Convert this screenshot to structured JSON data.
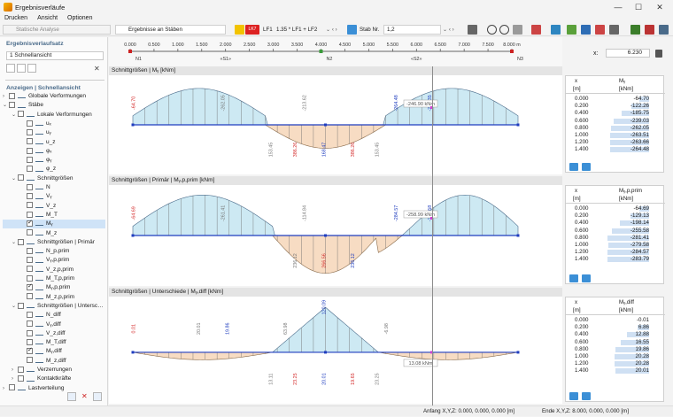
{
  "window": {
    "title": "Ergebnisverläufe"
  },
  "menu": [
    "Drucken",
    "Ansicht",
    "Optionen"
  ],
  "toolbar": {
    "analysis": "Statische Analyse",
    "results_on": "Ergebnisse an Stäben",
    "lc_code": "LK7",
    "lc_name": "LF1",
    "combo_text": "1.35 * LF1 + LF2",
    "member_label": "Stab Nr.",
    "member_value": "1,2"
  },
  "panel": {
    "title": "Ergebnisverlaufsatz",
    "selection": "1   Schnellansicht",
    "display_header": "Anzeigen | Schnellansicht",
    "tree": [
      {
        "label": "Globale Verformungen",
        "level": 0,
        "checked": false,
        "caret": ">"
      },
      {
        "label": "Stäbe",
        "level": 0,
        "checked": false,
        "caret": "v"
      },
      {
        "label": "Lokale Verformungen",
        "level": 1,
        "checked": false,
        "caret": "v"
      },
      {
        "label": "uₓ",
        "level": 2,
        "checked": false,
        "caret": ""
      },
      {
        "label": "uᵧ",
        "level": 2,
        "checked": false,
        "caret": ""
      },
      {
        "label": "u_z",
        "level": 2,
        "checked": false,
        "caret": ""
      },
      {
        "label": "φₓ",
        "level": 2,
        "checked": false,
        "caret": ""
      },
      {
        "label": "φᵧ",
        "level": 2,
        "checked": false,
        "caret": ""
      },
      {
        "label": "φ_z",
        "level": 2,
        "checked": false,
        "caret": ""
      },
      {
        "label": "Schnittgrößen",
        "level": 1,
        "checked": false,
        "caret": "v"
      },
      {
        "label": "N",
        "level": 2,
        "checked": false,
        "caret": ""
      },
      {
        "label": "Vᵧ",
        "level": 2,
        "checked": false,
        "caret": ""
      },
      {
        "label": "V_z",
        "level": 2,
        "checked": false,
        "caret": ""
      },
      {
        "label": "M_T",
        "level": 2,
        "checked": false,
        "caret": ""
      },
      {
        "label": "Mᵧ",
        "level": 2,
        "checked": true,
        "caret": "",
        "selected": true
      },
      {
        "label": "M_z",
        "level": 2,
        "checked": false,
        "caret": ""
      },
      {
        "label": "Schnittgrößen | Primär",
        "level": 1,
        "checked": false,
        "caret": "v"
      },
      {
        "label": "N_p,prim",
        "level": 2,
        "checked": false,
        "caret": ""
      },
      {
        "label": "Vᵧ,p,prim",
        "level": 2,
        "checked": false,
        "caret": ""
      },
      {
        "label": "V_z,p,prim",
        "level": 2,
        "checked": false,
        "caret": ""
      },
      {
        "label": "M_T,p,prim",
        "level": 2,
        "checked": false,
        "caret": ""
      },
      {
        "label": "Mᵧ,p,prim",
        "level": 2,
        "checked": true,
        "caret": ""
      },
      {
        "label": "M_z,p,prim",
        "level": 2,
        "checked": false,
        "caret": ""
      },
      {
        "label": "Schnittgrößen | Untersc…",
        "level": 1,
        "checked": false,
        "caret": "v"
      },
      {
        "label": "N_diff",
        "level": 2,
        "checked": false,
        "caret": ""
      },
      {
        "label": "Vᵧ,diff",
        "level": 2,
        "checked": false,
        "caret": ""
      },
      {
        "label": "V_z,diff",
        "level": 2,
        "checked": false,
        "caret": ""
      },
      {
        "label": "M_T,diff",
        "level": 2,
        "checked": false,
        "caret": ""
      },
      {
        "label": "Mᵧ,diff",
        "level": 2,
        "checked": true,
        "caret": ""
      },
      {
        "label": "M_z,diff",
        "level": 2,
        "checked": false,
        "caret": ""
      },
      {
        "label": "Verzerrungen",
        "level": 1,
        "checked": false,
        "caret": ">"
      },
      {
        "label": "Kontaktkräfte",
        "level": 1,
        "checked": false,
        "caret": ">"
      },
      {
        "label": "Lastverteilung",
        "level": 0,
        "checked": false,
        "caret": ">"
      }
    ]
  },
  "ruler": {
    "ticks": [
      "0.000",
      "0.500",
      "1.000",
      "1.500",
      "2.000",
      "2.500",
      "3.000",
      "3.500",
      "4.000",
      "4.500",
      "5.000",
      "5.500",
      "6.000",
      "6.500",
      "7.000",
      "7.500",
      "8.000 m"
    ],
    "nodes": [
      "N1",
      "N2",
      "N3"
    ],
    "members": [
      "«S1»",
      "«S2»"
    ],
    "x_label": "x:",
    "x_value": "6.230"
  },
  "charts": [
    {
      "header": "Schnittgrößen | Mᵧ [kNm]",
      "tooltip": "-246.90 kNm",
      "table_col": "Mᵧ",
      "table_unit": "[kNm]",
      "rows": [
        [
          "0.000",
          "-64.70"
        ],
        [
          "0.200",
          "-122.26"
        ],
        [
          "0.400",
          "-185.75"
        ],
        [
          "0.600",
          "-239.03"
        ],
        [
          "0.800",
          "-262.05"
        ],
        [
          "1.000",
          "-263.51"
        ],
        [
          "1.200",
          "-263.66"
        ],
        [
          "1.400",
          "-264.48"
        ]
      ],
      "labels_pos": [
        "-64.70",
        "-262.05",
        "-264.48",
        "-262.35",
        "-213.62"
      ],
      "labels_neg": [
        "153.45",
        "386.26",
        "168.47",
        "386.26",
        "153.45"
      ]
    },
    {
      "header": "Schnittgrößen | Primär | Mᵧ,p,prim [kNm]",
      "tooltip": "-258.99 kNm",
      "table_col": "Mᵧ,p,prim",
      "table_unit": "[kNm]",
      "rows": [
        [
          "0.000",
          "-64.69"
        ],
        [
          "0.200",
          "-129.13"
        ],
        [
          "0.400",
          "-198.14"
        ],
        [
          "0.600",
          "-255.58"
        ],
        [
          "0.800",
          "-281.41"
        ],
        [
          "1.000",
          "-279.58"
        ],
        [
          "1.200",
          "-284.57"
        ],
        [
          "1.400",
          "-283.79"
        ]
      ],
      "labels_pos": [
        "-64.69",
        "-261.41",
        "-284.57",
        "-279.58",
        "-114.84"
      ],
      "labels_neg": [
        "236.12",
        "266.56",
        "236.12"
      ]
    },
    {
      "header": "Schnittgrößen | Unterschiede | Mᵧ,diff [kNm]",
      "tooltip": "13.08 kNm",
      "table_col": "Mᵧ,diff",
      "table_unit": "[kNm]",
      "rows": [
        [
          "0.000",
          "-0.01"
        ],
        [
          "0.200",
          "6.86"
        ],
        [
          "0.400",
          "12.88"
        ],
        [
          "0.600",
          "16.55"
        ],
        [
          "0.800",
          "19.86"
        ],
        [
          "1.000",
          "20.28"
        ],
        [
          "1.200",
          "20.28"
        ],
        [
          "1.400",
          "20.01"
        ]
      ],
      "labels_pos": [
        "0.01",
        "20.01",
        "19.86",
        "120.09",
        "63.98",
        "-6.98"
      ],
      "labels_neg": [
        "13.11",
        "23.25",
        "20.01",
        "19.65",
        "23.25"
      ]
    }
  ],
  "table_x_col": "x",
  "table_x_unit": "[m]",
  "status": {
    "start": "Anfang X,Y,Z: 0.000, 0.000, 0.000 [m]",
    "end": "Ende X,Y,Z: 8.000, 0.000, 0.000 [m]"
  },
  "colors": {
    "positive": "#cde9f3",
    "negative": "#f7dcc3",
    "axis": "#1f3dbf",
    "label_red": "#d42a2a",
    "label_blue": "#1f3dbf"
  }
}
